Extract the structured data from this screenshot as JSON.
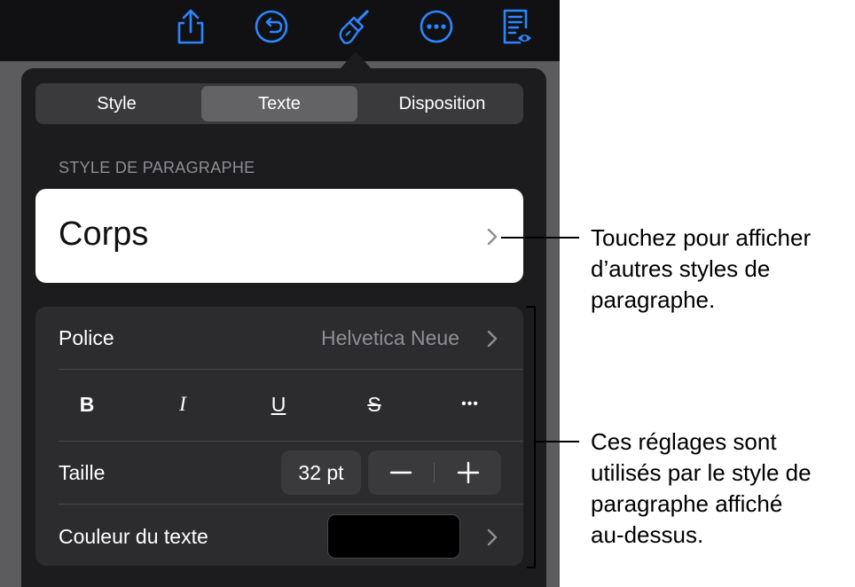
{
  "toolbar": {
    "icons": [
      "share-icon",
      "undo-icon",
      "format-paintbrush-icon",
      "more-icon",
      "reading-view-icon"
    ],
    "accent": "#2b86ff"
  },
  "tabs": [
    {
      "label": "Style",
      "selected": false
    },
    {
      "label": "Texte",
      "selected": true
    },
    {
      "label": "Disposition",
      "selected": false
    }
  ],
  "paragraph_style": {
    "header": "STYLE DE PARAGRAPHE",
    "value": "Corps"
  },
  "settings": {
    "font": {
      "label": "Police",
      "value": "Helvetica Neue"
    },
    "formatting": {
      "bold": "B",
      "italic": "I",
      "underline": "U",
      "strikethrough": "S",
      "more": "•••"
    },
    "size": {
      "label": "Taille",
      "value": "32 pt"
    },
    "text_color": {
      "label": "Couleur du texte",
      "color": "#000000"
    }
  },
  "callouts": {
    "paragraph_style": [
      "Touchez pour afficher",
      "d’autres styles de",
      "paragraphe."
    ],
    "settings": [
      "Ces réglages sont",
      "utilisés par le style de",
      "paragraphe affiché",
      "au-dessus."
    ]
  }
}
